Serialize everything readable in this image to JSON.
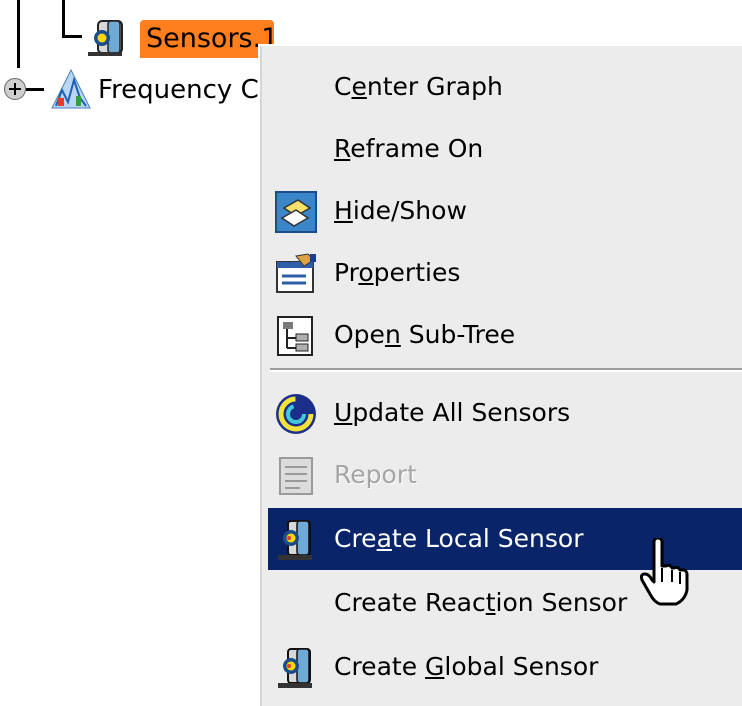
{
  "tree": {
    "sensors_node": {
      "label": "Sensors.1",
      "icon": "sensor-icon",
      "selected": true
    },
    "frequency_node": {
      "label": "Frequency C",
      "icon": "frequency-case-icon",
      "expander": "plus"
    }
  },
  "context_menu": {
    "items": [
      {
        "label_pre": "C",
        "mnemonic": "e",
        "label_post": "nter Graph",
        "icon": null
      },
      {
        "label_pre": "",
        "mnemonic": "R",
        "label_post": "eframe On",
        "icon": null
      },
      {
        "label_pre": "",
        "mnemonic": "H",
        "label_post": "ide/Show",
        "icon": "hide-show-icon"
      },
      {
        "label_pre": "Pr",
        "mnemonic": "o",
        "label_post": "perties",
        "icon": "properties-icon"
      },
      {
        "label_pre": "Ope",
        "mnemonic": "n",
        "label_post": " Sub-Tree",
        "icon": "sub-tree-icon"
      },
      {
        "label_pre": "",
        "mnemonic": "U",
        "label_post": "pdate All Sensors",
        "icon": "update-icon"
      },
      {
        "label_pre": "Report",
        "mnemonic": "",
        "label_post": "",
        "icon": "report-icon",
        "disabled": true
      },
      {
        "label_pre": "Cre",
        "mnemonic": "a",
        "label_post": "te Local Sensor",
        "icon": "local-sensor-icon",
        "highlighted": true
      },
      {
        "label_pre": "Create Reac",
        "mnemonic": "t",
        "label_post": "ion Sensor",
        "icon": null
      },
      {
        "label_pre": "Create ",
        "mnemonic": "G",
        "label_post": "lobal Sensor",
        "icon": "global-sensor-icon"
      }
    ]
  },
  "colors": {
    "selection_orange": "#ff7f1e",
    "menu_background": "#ececec",
    "highlight_navy": "#0a246a",
    "disabled_text": "#a6a6a6"
  },
  "cursor": {
    "icon": "hand-pointer-icon"
  }
}
